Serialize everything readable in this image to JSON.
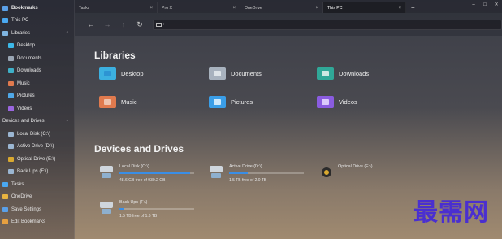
{
  "sidebar": {
    "items": [
      {
        "label": "Bookmarks",
        "level": 1,
        "icon": "bookmark-icon",
        "color": "#5aa0e8",
        "bold": true
      },
      {
        "label": "This PC",
        "level": 1,
        "icon": "monitor-icon",
        "color": "#4aa8f0"
      },
      {
        "label": "Libraries",
        "level": 1,
        "icon": "libraries-icon",
        "color": "#7fb4e0",
        "chevron": true
      },
      {
        "label": "Desktop",
        "level": 2,
        "icon": "desktop-folder-icon",
        "color": "#3cb8e8"
      },
      {
        "label": "Documents",
        "level": 2,
        "icon": "documents-folder-icon",
        "color": "#9aa6b4"
      },
      {
        "label": "Downloads",
        "level": 2,
        "icon": "downloads-folder-icon",
        "color": "#3fb0c8"
      },
      {
        "label": "Music",
        "level": 2,
        "icon": "music-folder-icon",
        "color": "#e07a4e"
      },
      {
        "label": "Pictures",
        "level": 2,
        "icon": "pictures-folder-icon",
        "color": "#4fa8e8"
      },
      {
        "label": "Videos",
        "level": 2,
        "icon": "videos-folder-icon",
        "color": "#9a66e0"
      },
      {
        "label": "Devices and Drives",
        "level": 1,
        "icon": "",
        "color": "",
        "chevron": true
      },
      {
        "label": "Local Disk (C:\\)",
        "level": 2,
        "icon": "disk-icon",
        "color": "#9bb6d2"
      },
      {
        "label": "Active Drive (D:\\)",
        "level": 2,
        "icon": "disk-icon",
        "color": "#9bb6d2"
      },
      {
        "label": "Optical Drive (E:\\)",
        "level": 2,
        "icon": "optical-drive-icon",
        "color": "#d9a930"
      },
      {
        "label": "Back Ups (F:\\)",
        "level": 2,
        "icon": "disk-icon",
        "color": "#9bb6d2"
      },
      {
        "label": "Tasks",
        "level": 1,
        "icon": "tasks-icon",
        "color": "#4aa8f0"
      },
      {
        "label": "OneDrive",
        "level": 1,
        "icon": "folder-icon",
        "color": "#e8b440"
      },
      {
        "label": "Save Settings",
        "level": 1,
        "icon": "save-icon",
        "color": "#5aa0e8"
      },
      {
        "label": "Edit Bookmarks",
        "level": 1,
        "icon": "edit-icon",
        "color": "#e6a040"
      }
    ]
  },
  "tabs": [
    {
      "label": "Tasks",
      "active": false
    },
    {
      "label": "Pro X",
      "active": false
    },
    {
      "label": "OneDrive",
      "active": false
    },
    {
      "label": "This PC",
      "active": true
    }
  ],
  "tab_add": "+",
  "window_controls": {
    "minimize": "–",
    "maximize": "□",
    "close": "✕"
  },
  "toolbar": {
    "back": "←",
    "forward": "→",
    "up": "↑",
    "refresh": "↻",
    "address": "›"
  },
  "libraries": {
    "heading": "Libraries",
    "items": [
      {
        "label": "Desktop",
        "color": "#3cb0e0",
        "accent": "#2a8fd0"
      },
      {
        "label": "Documents",
        "color": "#a8b2be",
        "accent": "#e8ecf0"
      },
      {
        "label": "Downloads",
        "color": "#30a898",
        "accent": "#e8f4f0"
      },
      {
        "label": "Music",
        "color": "#e07a4e",
        "accent": "#f0d0c0"
      },
      {
        "label": "Pictures",
        "color": "#3a9ee8",
        "accent": "#e8f4ff"
      },
      {
        "label": "Videos",
        "color": "#8a5ce0",
        "accent": "#e8dcff"
      }
    ]
  },
  "devices": {
    "heading": "Devices and Drives",
    "drives": [
      {
        "name": "Local Disk (C:\\)",
        "space": "48.6 GB free of 930.2 GB",
        "used_fraction": 0.95,
        "type": "disk"
      },
      {
        "name": "Active Drive (D:\\)",
        "space": "1.5 TB free of 2.0 TB",
        "used_fraction": 0.25,
        "type": "disk"
      },
      {
        "name": "Optical Drive (E:\\)",
        "space": "",
        "used_fraction": null,
        "type": "optical"
      },
      {
        "name": "Back Ups (F:\\)",
        "space": "1.5 TB free of 1.6 TB",
        "used_fraction": 0.06,
        "type": "disk"
      }
    ]
  },
  "watermark": "最需网",
  "colors": {
    "accent": "#3a8ee6",
    "watermark": "#4a2fd0"
  }
}
